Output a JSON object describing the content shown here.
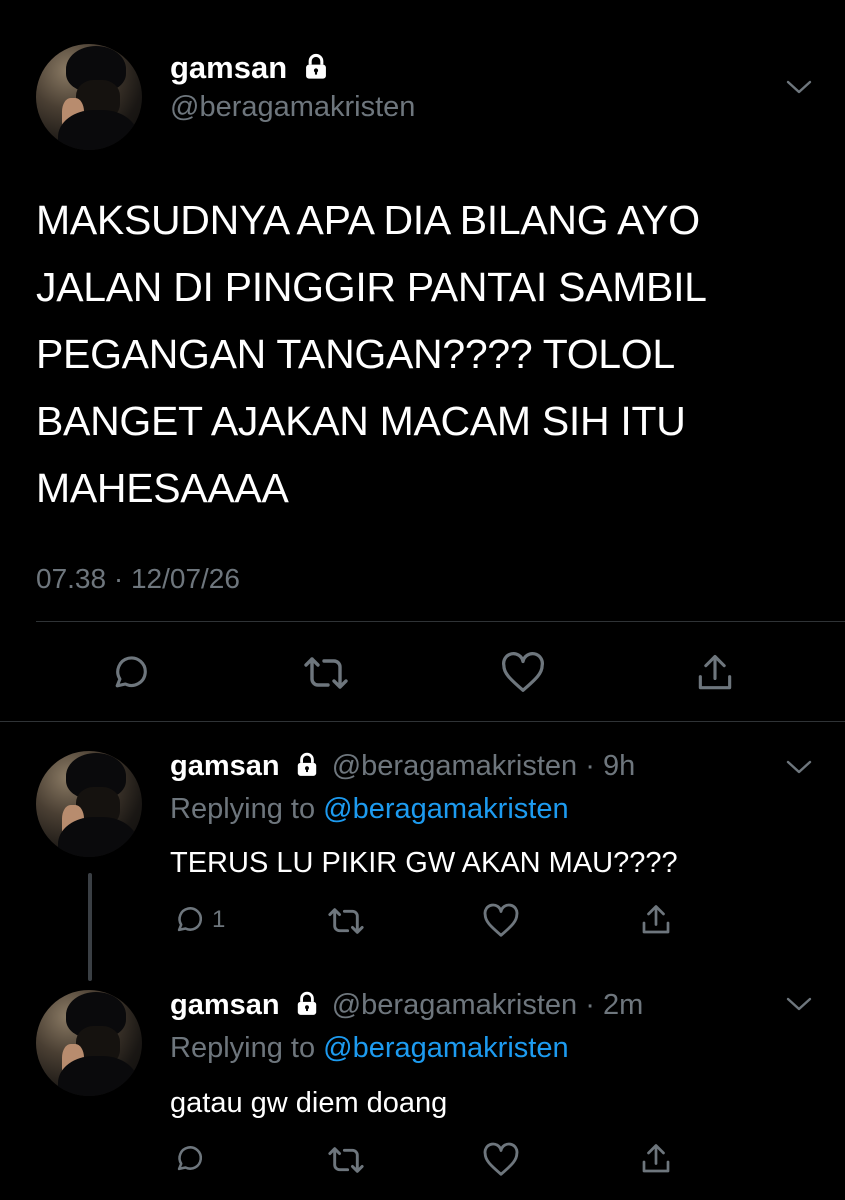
{
  "main_tweet": {
    "display_name": "gamsan",
    "handle": "@beragamakristen",
    "text_lines": [
      "MAKSUDNYA APA DIA BILANG AYO",
      "JALAN DI PINGGIR PANTAI SAMBIL",
      "PEGANGAN TANGAN???? TOLOL",
      "BANGET AJAKAN MACAM SIH ITU",
      "MAHESAAAA"
    ],
    "timestamp": "07.38 · 12/07/26"
  },
  "replies": [
    {
      "display_name": "gamsan",
      "handle_time": "@beragamakristen · 9h",
      "replying_prefix": "Replying to",
      "replying_handle": "@beragamakristen",
      "text": "TERUS LU PIKIR GW AKAN MAU????",
      "reply_count": "1"
    },
    {
      "display_name": "gamsan",
      "handle_time": "@beragamakristen · 2m",
      "replying_prefix": "Replying to",
      "replying_handle": "@beragamakristen",
      "text": "gatau gw diem doang"
    }
  ],
  "icons": {
    "lock": "lock-icon",
    "chevron": "chevron-down-icon",
    "reply": "reply-icon",
    "retweet": "retweet-icon",
    "like": "heart-icon",
    "share": "share-icon"
  },
  "colors": {
    "background": "#000000",
    "text": "#ffffff",
    "muted": "#6e767d",
    "link": "#1d9bf0",
    "divider": "#2f3336"
  }
}
